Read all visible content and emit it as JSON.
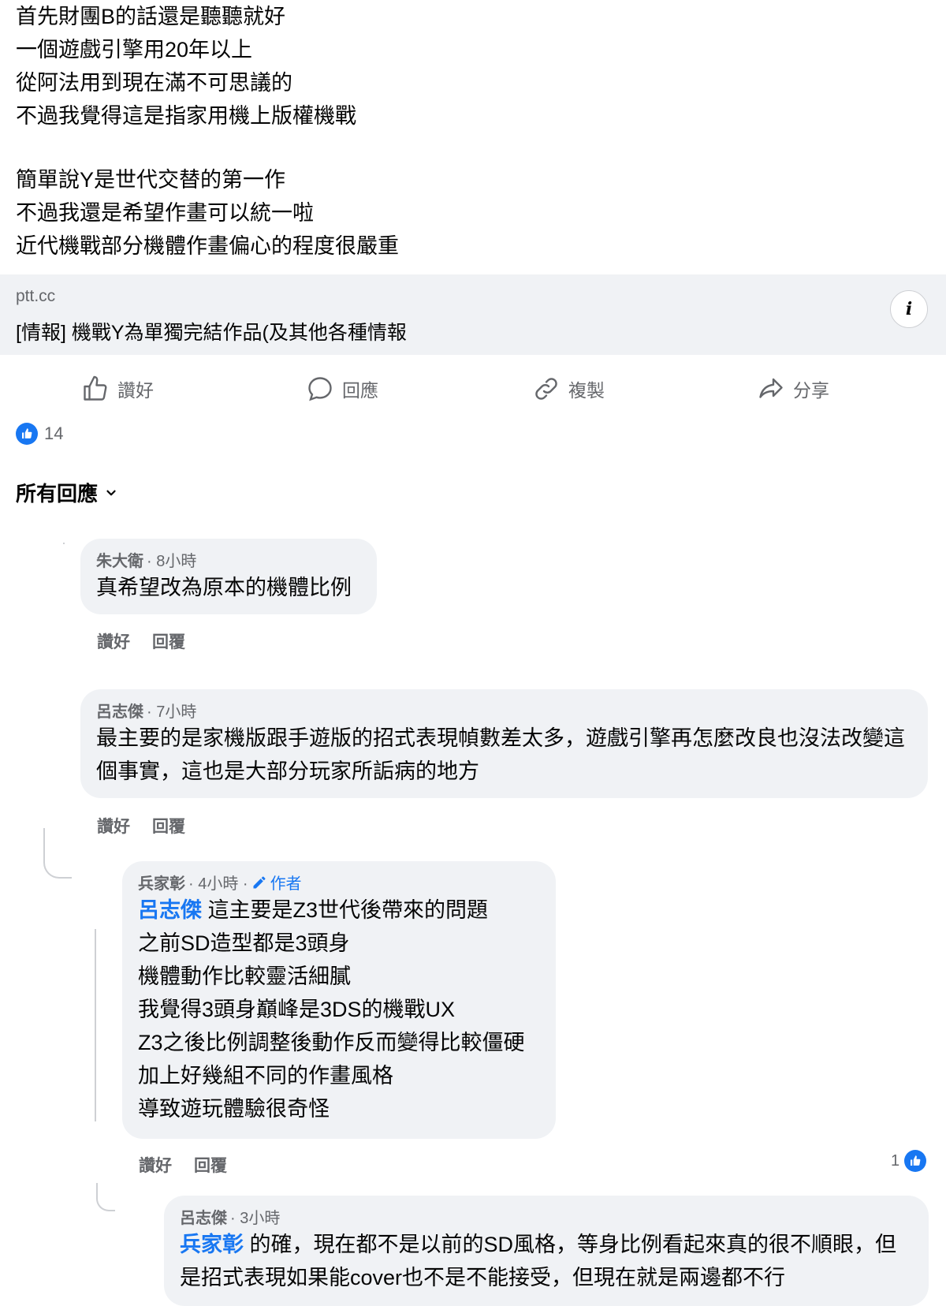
{
  "post": {
    "lines": [
      "首先財團B的話還是聽聽就好",
      "一個遊戲引擎用20年以上",
      "從阿法用到現在滿不可思議的",
      "不過我覺得這是指家用機上版權機戰",
      "簡單說Y是世代交替的第一作",
      "不過我還是希望作畫可以統一啦",
      "近代機戰部分機體作畫偏心的程度很嚴重"
    ]
  },
  "link": {
    "domain": "ptt.cc",
    "title": "[情報] 機戰Y為單獨完結作品(及其他各種情報"
  },
  "actions": {
    "like": "讚好",
    "comment": "回應",
    "copy": "複製",
    "share": "分享"
  },
  "reactions": {
    "count": "14"
  },
  "sort": {
    "label": "所有回應"
  },
  "comments": [
    {
      "author": "朱大衛",
      "time": "· 8小時",
      "text": "真希望改為原本的機體比例",
      "like": "讚好",
      "reply": "回覆"
    },
    {
      "author": "呂志傑",
      "time": "· 7小時",
      "text": "最主要的是家機版跟手遊版的招式表現幀數差太多，遊戲引擎再怎麼改良也沒法改變這個事實，這也是大部分玩家所詬病的地方",
      "like": "讚好",
      "reply": "回覆"
    },
    {
      "author": "兵家彰",
      "time": "· 4小時 ·",
      "badge": "作者",
      "mention": "呂志傑",
      "lines": [
        "這主要是Z3世代後帶來的問題",
        "之前SD造型都是3頭身",
        "機體動作比較靈活細膩",
        "我覺得3頭身巔峰是3DS的機戰UX",
        "Z3之後比例調整後動作反而變得比較僵硬",
        "加上好幾組不同的作畫風格",
        "導致遊玩體驗很奇怪"
      ],
      "like": "讚好",
      "reply": "回覆",
      "reaction_count": "1"
    },
    {
      "author": "呂志傑",
      "time": "· 3小時",
      "mention": "兵家彰",
      "text": "的確，現在都不是以前的SD風格，等身比例看起來真的很不順眼，但是招式表現如果能cover也不是不能接受，但現在就是兩邊都不行"
    }
  ],
  "colors": {
    "accent": "#1877f2",
    "bubble": "#f0f2f5",
    "secondary_text": "#65676b"
  }
}
